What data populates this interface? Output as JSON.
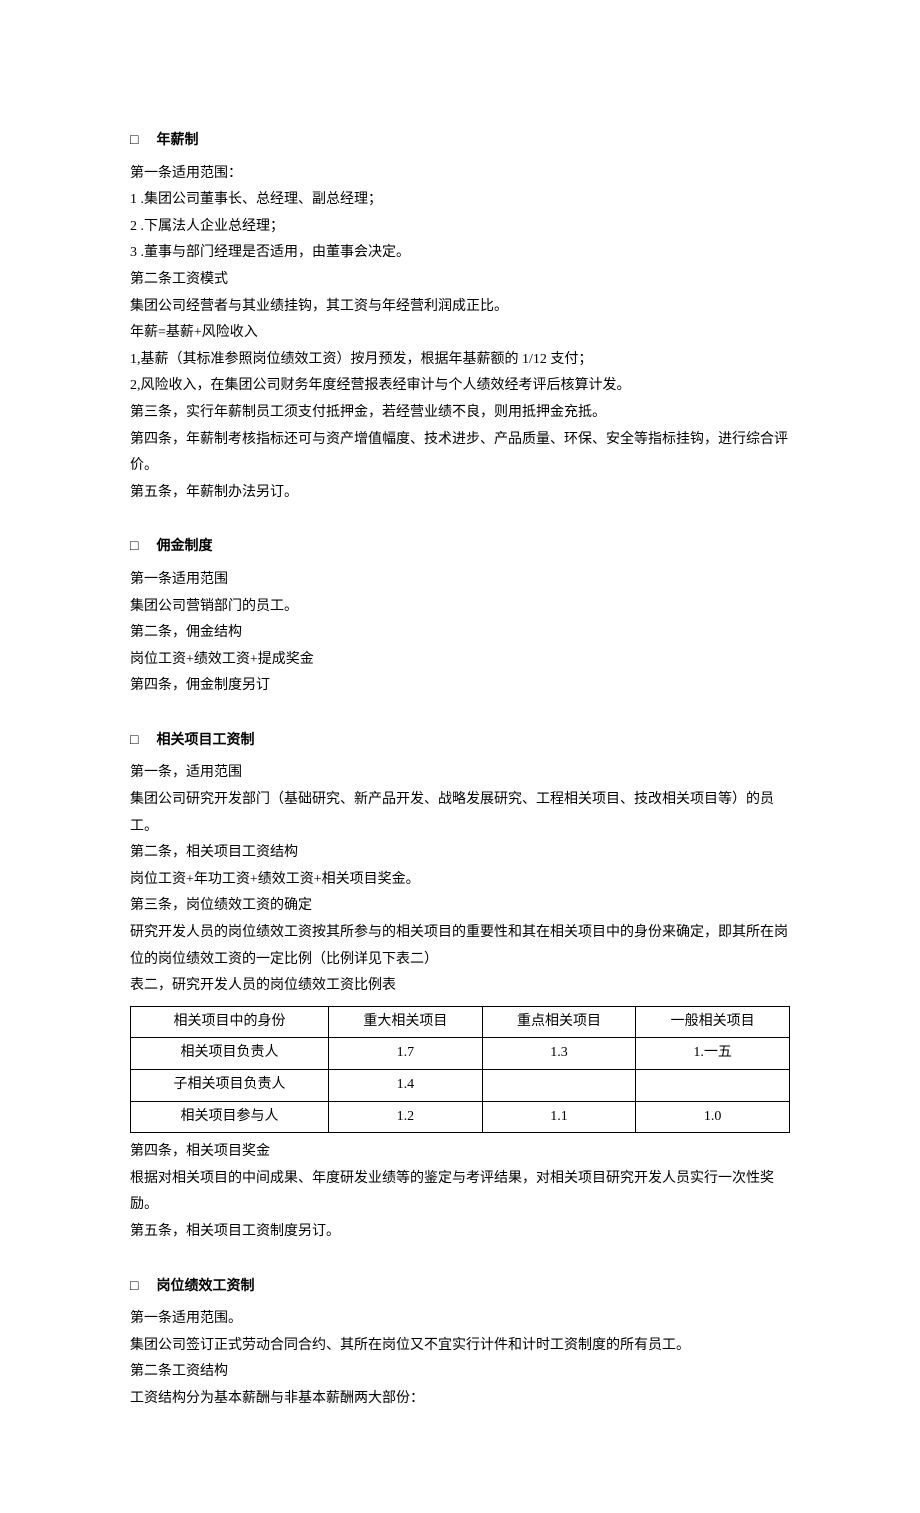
{
  "s1": {
    "title": "年薪制",
    "lines": [
      "第一条适用范围：",
      "1  .集团公司董事长、总经理、副总经理；",
      "2  .下属法人企业总经理；",
      "3  .董事与部门经理是否适用，由董事会决定。",
      "第二条工资模式",
      "集团公司经营者与其业绩挂钩，其工资与年经营利润成正比。",
      "年薪=基薪+风险收入",
      "1,基薪（其标准参照岗位绩效工资）按月预发，根据年基薪额的 1/12 支付；",
      "2,风险收入，在集团公司财务年度经营报表经审计与个人绩效经考评后核算计发。",
      "第三条，实行年薪制员工须支付抵押金，若经营业绩不良，则用抵押金充抵。",
      "第四条，年薪制考核指标还可与资产增值幅度、技术进步、产品质量、环保、安全等指标挂钩，进行综合评价。",
      "第五条，年薪制办法另订。"
    ]
  },
  "s2": {
    "title": "佣金制度",
    "lines": [
      "第一条适用范围",
      "集团公司营销部门的员工。",
      "第二条，佣金结构",
      "岗位工资+绩效工资+提成奖金",
      "第四条，佣金制度另订"
    ]
  },
  "s3": {
    "title": "相关项目工资制",
    "before": [
      "第一条，适用范围",
      "集团公司研究开发部门（基础研究、新产品开发、战略发展研究、工程相关项目、技改相关项目等）的员工。",
      "第二条，相关项目工资结构",
      "岗位工资+年功工资+绩效工资+相关项目奖金。",
      "第三条，岗位绩效工资的确定",
      "研究开发人员的岗位绩效工资按其所参与的相关项目的重要性和其在相关项目中的身份来确定，即其所在岗位的岗位绩效工资的一定比例（比例详见下表二）",
      "表二，研究开发人员的岗位绩效工资比例表"
    ],
    "table": {
      "headers": [
        "相关项目中的身份",
        "重大相关项目",
        "重点相关项目",
        "一般相关项目"
      ],
      "rows": [
        [
          "相关项目负责人",
          "1.7",
          "1.3",
          "1.一五"
        ],
        [
          "子相关项目负责人",
          "1.4",
          "",
          ""
        ],
        [
          "相关项目参与人",
          "1.2",
          "1.1",
          "1.0"
        ]
      ]
    },
    "after": [
      "第四条，相关项目奖金",
      "根据对相关项目的中间成果、年度研发业绩等的鉴定与考评结果，对相关项目研究开发人员实行一次性奖励。",
      "第五条，相关项目工资制度另订。"
    ]
  },
  "s4": {
    "title": "岗位绩效工资制",
    "lines": [
      "第一条适用范围。",
      "集团公司签订正式劳动合同合约、其所在岗位又不宜实行计件和计时工资制度的所有员工。",
      "第二条工资结构",
      "工资结构分为基本薪酬与非基本薪酬两大部份："
    ]
  }
}
